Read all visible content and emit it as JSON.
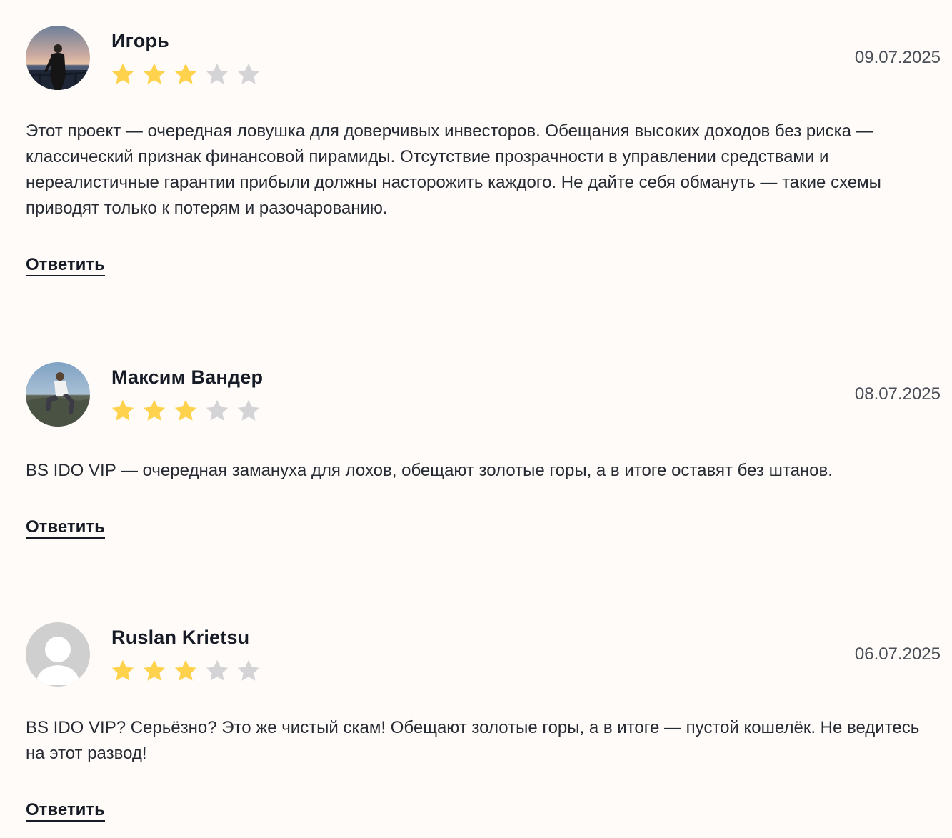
{
  "colors": {
    "background": "#fffbf8",
    "star_filled": "#ffd24d",
    "star_empty": "#d4d4d6",
    "text": "#262a33"
  },
  "reviews": [
    {
      "author": "Игорь",
      "date": "09.07.2025",
      "rating": 3,
      "max_rating": 5,
      "avatar": "photo-avatar",
      "text": "Этот проект — очередная ловушка для доверчивых инвесторов. Обещания высоких доходов без риска — классический признак финансовой пирамиды. Отсутствие прозрачности в управлении средствами и нереалистичные гарантии прибыли должны насторожить каждого. Не дайте себя обмануть — такие схемы приводят только к потерям и разочарованию.",
      "reply_label": "Ответить"
    },
    {
      "author": "Максим Вандер",
      "date": "08.07.2025",
      "rating": 3,
      "max_rating": 5,
      "avatar": "photo-avatar",
      "text": "BS IDO VIP — очередная замануха для лохов, обещают золотые горы, а в итоге оставят без штанов.",
      "reply_label": "Ответить"
    },
    {
      "author": "Ruslan Krietsu",
      "date": "06.07.2025",
      "rating": 3,
      "max_rating": 5,
      "avatar": "default-user-icon",
      "text": "BS IDO VIP? Серьёзно? Это же чистый скам! Обещают золотые горы, а в итоге — пустой кошелёк. Не ведитесь на этот развод!",
      "reply_label": "Ответить"
    }
  ]
}
